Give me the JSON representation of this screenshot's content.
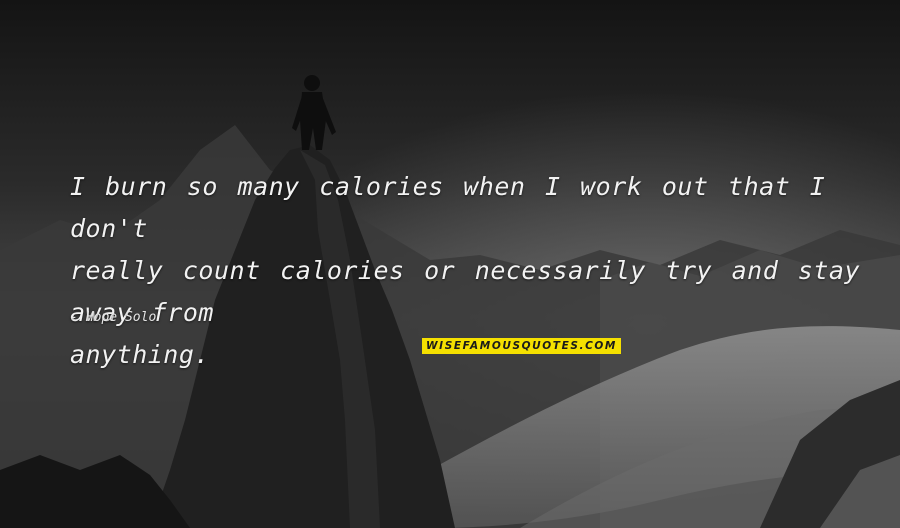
{
  "quote": {
    "lines": [
      "I burn so many calories when I work out that I don't",
      "really count calories or necessarily try and stay away from",
      "anything."
    ]
  },
  "author": {
    "dash": "-",
    "name": "Hope Solo"
  },
  "watermark": {
    "text": "WISEFAMOUSQUOTES.COM",
    "background": "#f5e000"
  },
  "colors": {
    "text": "#f2f2f2",
    "background": "#1a1a1a"
  }
}
